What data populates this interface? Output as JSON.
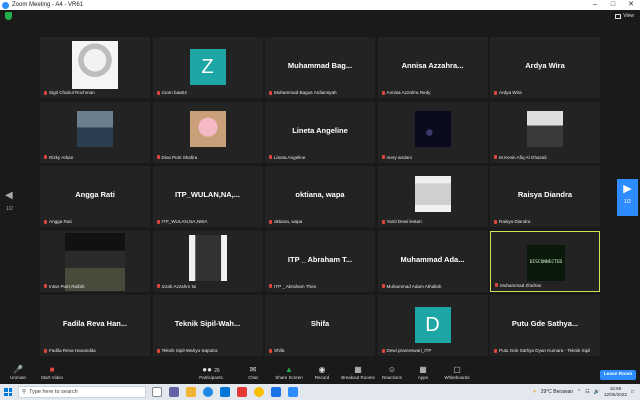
{
  "window": {
    "title": "Zoom Meeting - A4 - VR61",
    "controls": [
      "–",
      "□",
      "✕"
    ]
  },
  "topbar": {
    "view_label": "View"
  },
  "navigation": {
    "prev_page": "1/2",
    "next_page": "1/2"
  },
  "tiles": [
    {
      "label": "Sigit Chairul Rochman",
      "display": "photo",
      "photo_kind": "sketch"
    },
    {
      "label": "zoom baa04",
      "display": "avatar",
      "avatar_letter": "Z",
      "avatar_color": "#1ea6a6"
    },
    {
      "label": "Muhammad Bagus Ardiansyah",
      "display": "name",
      "big_name": "Muhammad  Bag..."
    },
    {
      "label": "Annisa Azzahra Redy",
      "display": "name",
      "big_name": "Annisa  Azzahra..."
    },
    {
      "label": "Ardya Wira",
      "display": "name",
      "big_name": "Ardya Wira"
    },
    {
      "label": "Rizky Arkan",
      "display": "photo",
      "photo_kind": "interior"
    },
    {
      "label": "Diva Putri Shafira",
      "display": "photo",
      "photo_kind": "pink"
    },
    {
      "label": "Lineta Angeline",
      "display": "name",
      "big_name": "Lineta Angeline"
    },
    {
      "label": "mery andani",
      "display": "photo",
      "photo_kind": "night"
    },
    {
      "label": "M.Kevin Afiq Al Ghazali",
      "display": "photo",
      "photo_kind": "sitting"
    },
    {
      "label": "Angga Rati",
      "display": "name",
      "big_name": "Angga Rati"
    },
    {
      "label": "ITP_WULAN,NA,NWA",
      "display": "name",
      "big_name": "ITP_WULAN,NA,..."
    },
    {
      "label": "oktiana, wapa",
      "display": "name",
      "big_name": "oktiana, wapa"
    },
    {
      "label": "Yanti Dewi lestari",
      "display": "photo",
      "photo_kind": "frame"
    },
    {
      "label": "Raisya Diandra",
      "display": "name",
      "big_name": "Raisya Diandra"
    },
    {
      "label": "Intan Putri Raifah",
      "display": "photo",
      "photo_kind": "city"
    },
    {
      "label": "Izzah Azzahro tsi",
      "display": "photo",
      "photo_kind": "dark"
    },
    {
      "label": "ITP _ Abraham Theo",
      "display": "name",
      "big_name": "ITP _ Abraham T..."
    },
    {
      "label": "Muhammad Adam Athallah",
      "display": "name",
      "big_name": "Muhammad  Ada..."
    },
    {
      "label": "Muhammad Zhafran",
      "display": "disconnected",
      "status_text": "DISCONNECTED",
      "active": true
    },
    {
      "label": "Fadila Reva Hanandita",
      "display": "name",
      "big_name": "Fadila Reva Han..."
    },
    {
      "label": "Teknik Sipil-Wahyu Saputra",
      "display": "name",
      "big_name": "Teknik  Sipil-Wah..."
    },
    {
      "label": "Shifa",
      "display": "name",
      "big_name": "Shifa"
    },
    {
      "label": "Dewi prameswari_ITP",
      "display": "avatar",
      "avatar_letter": "D",
      "avatar_color": "#1ea6a6"
    },
    {
      "label": "Putu Gde Sathya Dyan Kumara - Teknik Sipil",
      "display": "name",
      "big_name": "Putu Gde Sathya..."
    }
  ],
  "toolbar": {
    "unmute": "Unmute",
    "start_video": "Start Video",
    "participants": "Participants",
    "participants_count": "26",
    "chat": "Chat",
    "share_screen": "Share Screen",
    "record": "Record",
    "breakout_rooms": "Breakout Rooms",
    "reactions": "Reactions",
    "apps": "Apps",
    "whiteboards": "Whiteboards",
    "leave": "Leave Room"
  },
  "taskbar": {
    "search_placeholder": "Type here to search",
    "weather": "29°C  Berawan",
    "time": "15:59",
    "date": "12/06/2022"
  },
  "colors": {
    "accent": "#2d8cff",
    "active_border": "#d6e05a",
    "muted_mic": "#e0463e",
    "share": "#23b04b"
  }
}
